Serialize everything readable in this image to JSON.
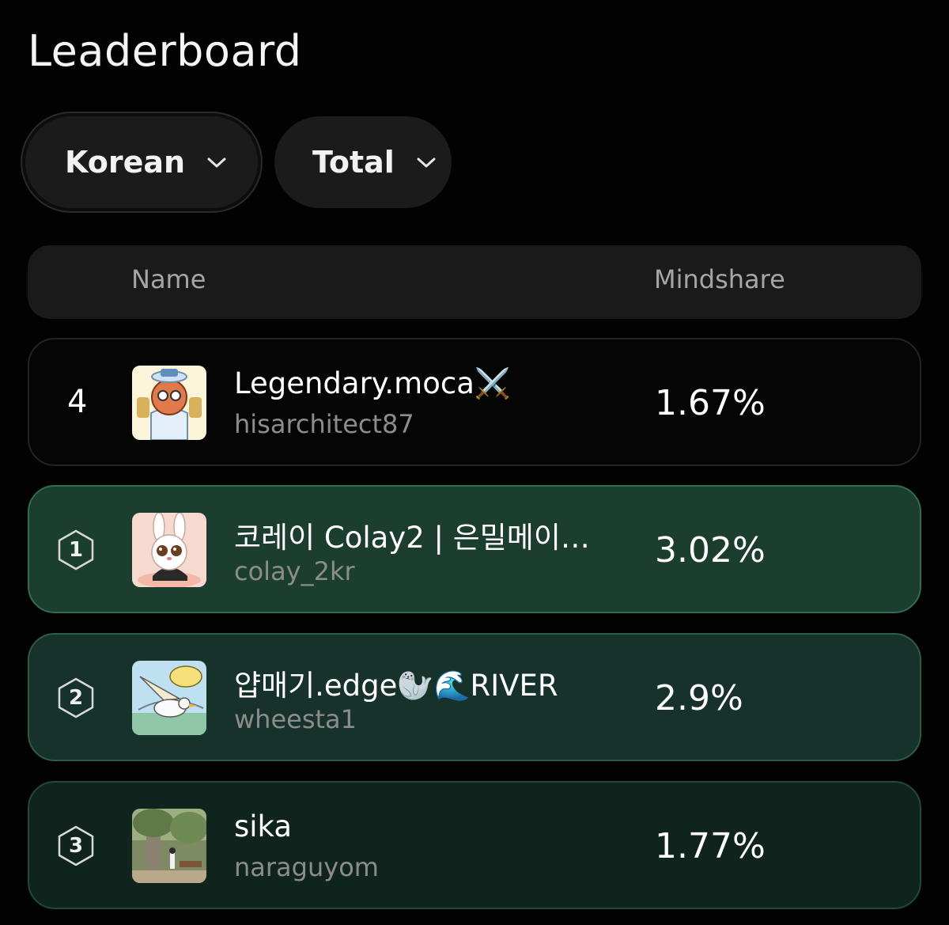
{
  "page": {
    "title": "Leaderboard"
  },
  "filters": {
    "language": {
      "label": "Korean"
    },
    "period": {
      "label": "Total"
    }
  },
  "table": {
    "headers": {
      "name": "Name",
      "mindshare": "Mindshare"
    }
  },
  "current_user": {
    "rank": "4",
    "display_name": "Legendary.moca⚔️",
    "handle": "hisarchitect87",
    "mindshare": "1.67%"
  },
  "rows": [
    {
      "rank": "1",
      "display_name": "코레이 Colay2 | 은밀메이…",
      "handle": "colay_2kr",
      "mindshare": "3.02%"
    },
    {
      "rank": "2",
      "display_name": "얍매기.edge🦭🌊RIVER",
      "handle": "wheesta1",
      "mindshare": "2.9%"
    },
    {
      "rank": "3",
      "display_name": "sika",
      "handle": "naraguyom",
      "mindshare": "1.77%"
    }
  ],
  "icons": {
    "filter_chevron": "chevron-down-icon",
    "rank_badge": "hexagon-icon"
  },
  "colors": {
    "background": "#020202",
    "rank1_row": "#1b3e2f",
    "rank2_row": "#17322a",
    "rank3_row": "#0f241d"
  }
}
